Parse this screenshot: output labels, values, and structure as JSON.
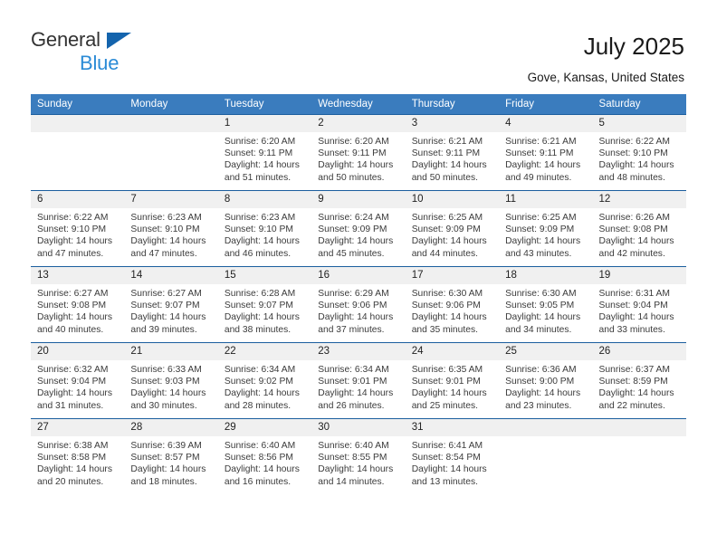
{
  "brand": {
    "name_top": "General",
    "name_bottom": "Blue",
    "accent_top": "#1464ad",
    "accent_bottom": "#2b8bd6"
  },
  "header": {
    "title": "July 2025",
    "location": "Gove, Kansas, United States"
  },
  "theme": {
    "header_bg": "#3a7cbe",
    "row_rule": "#1b5e9e",
    "daynum_bg": "#f0f0f0"
  },
  "calendar": {
    "weekday_headers": [
      "Sunday",
      "Monday",
      "Tuesday",
      "Wednesday",
      "Thursday",
      "Friday",
      "Saturday"
    ],
    "weeks": [
      [
        {
          "day": "",
          "sunrise": "",
          "sunset": "",
          "daylight1": "",
          "daylight2": ""
        },
        {
          "day": "",
          "sunrise": "",
          "sunset": "",
          "daylight1": "",
          "daylight2": ""
        },
        {
          "day": "1",
          "sunrise": "Sunrise: 6:20 AM",
          "sunset": "Sunset: 9:11 PM",
          "daylight1": "Daylight: 14 hours",
          "daylight2": "and 51 minutes."
        },
        {
          "day": "2",
          "sunrise": "Sunrise: 6:20 AM",
          "sunset": "Sunset: 9:11 PM",
          "daylight1": "Daylight: 14 hours",
          "daylight2": "and 50 minutes."
        },
        {
          "day": "3",
          "sunrise": "Sunrise: 6:21 AM",
          "sunset": "Sunset: 9:11 PM",
          "daylight1": "Daylight: 14 hours",
          "daylight2": "and 50 minutes."
        },
        {
          "day": "4",
          "sunrise": "Sunrise: 6:21 AM",
          "sunset": "Sunset: 9:11 PM",
          "daylight1": "Daylight: 14 hours",
          "daylight2": "and 49 minutes."
        },
        {
          "day": "5",
          "sunrise": "Sunrise: 6:22 AM",
          "sunset": "Sunset: 9:10 PM",
          "daylight1": "Daylight: 14 hours",
          "daylight2": "and 48 minutes."
        }
      ],
      [
        {
          "day": "6",
          "sunrise": "Sunrise: 6:22 AM",
          "sunset": "Sunset: 9:10 PM",
          "daylight1": "Daylight: 14 hours",
          "daylight2": "and 47 minutes."
        },
        {
          "day": "7",
          "sunrise": "Sunrise: 6:23 AM",
          "sunset": "Sunset: 9:10 PM",
          "daylight1": "Daylight: 14 hours",
          "daylight2": "and 47 minutes."
        },
        {
          "day": "8",
          "sunrise": "Sunrise: 6:23 AM",
          "sunset": "Sunset: 9:10 PM",
          "daylight1": "Daylight: 14 hours",
          "daylight2": "and 46 minutes."
        },
        {
          "day": "9",
          "sunrise": "Sunrise: 6:24 AM",
          "sunset": "Sunset: 9:09 PM",
          "daylight1": "Daylight: 14 hours",
          "daylight2": "and 45 minutes."
        },
        {
          "day": "10",
          "sunrise": "Sunrise: 6:25 AM",
          "sunset": "Sunset: 9:09 PM",
          "daylight1": "Daylight: 14 hours",
          "daylight2": "and 44 minutes."
        },
        {
          "day": "11",
          "sunrise": "Sunrise: 6:25 AM",
          "sunset": "Sunset: 9:09 PM",
          "daylight1": "Daylight: 14 hours",
          "daylight2": "and 43 minutes."
        },
        {
          "day": "12",
          "sunrise": "Sunrise: 6:26 AM",
          "sunset": "Sunset: 9:08 PM",
          "daylight1": "Daylight: 14 hours",
          "daylight2": "and 42 minutes."
        }
      ],
      [
        {
          "day": "13",
          "sunrise": "Sunrise: 6:27 AM",
          "sunset": "Sunset: 9:08 PM",
          "daylight1": "Daylight: 14 hours",
          "daylight2": "and 40 minutes."
        },
        {
          "day": "14",
          "sunrise": "Sunrise: 6:27 AM",
          "sunset": "Sunset: 9:07 PM",
          "daylight1": "Daylight: 14 hours",
          "daylight2": "and 39 minutes."
        },
        {
          "day": "15",
          "sunrise": "Sunrise: 6:28 AM",
          "sunset": "Sunset: 9:07 PM",
          "daylight1": "Daylight: 14 hours",
          "daylight2": "and 38 minutes."
        },
        {
          "day": "16",
          "sunrise": "Sunrise: 6:29 AM",
          "sunset": "Sunset: 9:06 PM",
          "daylight1": "Daylight: 14 hours",
          "daylight2": "and 37 minutes."
        },
        {
          "day": "17",
          "sunrise": "Sunrise: 6:30 AM",
          "sunset": "Sunset: 9:06 PM",
          "daylight1": "Daylight: 14 hours",
          "daylight2": "and 35 minutes."
        },
        {
          "day": "18",
          "sunrise": "Sunrise: 6:30 AM",
          "sunset": "Sunset: 9:05 PM",
          "daylight1": "Daylight: 14 hours",
          "daylight2": "and 34 minutes."
        },
        {
          "day": "19",
          "sunrise": "Sunrise: 6:31 AM",
          "sunset": "Sunset: 9:04 PM",
          "daylight1": "Daylight: 14 hours",
          "daylight2": "and 33 minutes."
        }
      ],
      [
        {
          "day": "20",
          "sunrise": "Sunrise: 6:32 AM",
          "sunset": "Sunset: 9:04 PM",
          "daylight1": "Daylight: 14 hours",
          "daylight2": "and 31 minutes."
        },
        {
          "day": "21",
          "sunrise": "Sunrise: 6:33 AM",
          "sunset": "Sunset: 9:03 PM",
          "daylight1": "Daylight: 14 hours",
          "daylight2": "and 30 minutes."
        },
        {
          "day": "22",
          "sunrise": "Sunrise: 6:34 AM",
          "sunset": "Sunset: 9:02 PM",
          "daylight1": "Daylight: 14 hours",
          "daylight2": "and 28 minutes."
        },
        {
          "day": "23",
          "sunrise": "Sunrise: 6:34 AM",
          "sunset": "Sunset: 9:01 PM",
          "daylight1": "Daylight: 14 hours",
          "daylight2": "and 26 minutes."
        },
        {
          "day": "24",
          "sunrise": "Sunrise: 6:35 AM",
          "sunset": "Sunset: 9:01 PM",
          "daylight1": "Daylight: 14 hours",
          "daylight2": "and 25 minutes."
        },
        {
          "day": "25",
          "sunrise": "Sunrise: 6:36 AM",
          "sunset": "Sunset: 9:00 PM",
          "daylight1": "Daylight: 14 hours",
          "daylight2": "and 23 minutes."
        },
        {
          "day": "26",
          "sunrise": "Sunrise: 6:37 AM",
          "sunset": "Sunset: 8:59 PM",
          "daylight1": "Daylight: 14 hours",
          "daylight2": "and 22 minutes."
        }
      ],
      [
        {
          "day": "27",
          "sunrise": "Sunrise: 6:38 AM",
          "sunset": "Sunset: 8:58 PM",
          "daylight1": "Daylight: 14 hours",
          "daylight2": "and 20 minutes."
        },
        {
          "day": "28",
          "sunrise": "Sunrise: 6:39 AM",
          "sunset": "Sunset: 8:57 PM",
          "daylight1": "Daylight: 14 hours",
          "daylight2": "and 18 minutes."
        },
        {
          "day": "29",
          "sunrise": "Sunrise: 6:40 AM",
          "sunset": "Sunset: 8:56 PM",
          "daylight1": "Daylight: 14 hours",
          "daylight2": "and 16 minutes."
        },
        {
          "day": "30",
          "sunrise": "Sunrise: 6:40 AM",
          "sunset": "Sunset: 8:55 PM",
          "daylight1": "Daylight: 14 hours",
          "daylight2": "and 14 minutes."
        },
        {
          "day": "31",
          "sunrise": "Sunrise: 6:41 AM",
          "sunset": "Sunset: 8:54 PM",
          "daylight1": "Daylight: 14 hours",
          "daylight2": "and 13 minutes."
        },
        {
          "day": "",
          "sunrise": "",
          "sunset": "",
          "daylight1": "",
          "daylight2": ""
        },
        {
          "day": "",
          "sunrise": "",
          "sunset": "",
          "daylight1": "",
          "daylight2": ""
        }
      ]
    ]
  }
}
